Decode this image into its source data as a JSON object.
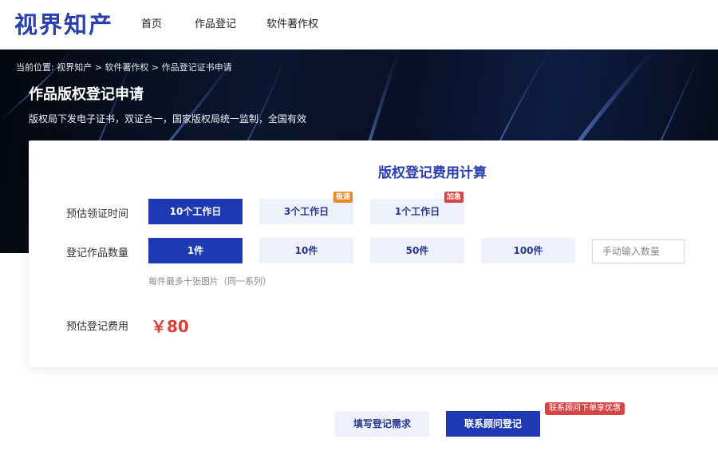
{
  "brand": {
    "logo_text": "视界知产"
  },
  "nav": {
    "items": [
      "首页",
      "作品登记",
      "软件著作权"
    ]
  },
  "hero": {
    "breadcrumb": "当前位置: 视界知产 > 软件著作权 > 作品登记证书申请",
    "title": "作品版权登记申请",
    "subtitle": "版权局下发电子证书，双证合一，国家版权局统一监制，全国有效"
  },
  "calculator": {
    "title": "版权登记费用计算",
    "time": {
      "label": "预估领证时间",
      "options": [
        {
          "label": "10个工作日",
          "selected": true,
          "tag": ""
        },
        {
          "label": "3个工作日",
          "selected": false,
          "tag": "极速"
        },
        {
          "label": "1个工作日",
          "selected": false,
          "tag": "加急"
        }
      ]
    },
    "quantity": {
      "label": "登记作品数量",
      "options": [
        {
          "label": "1件",
          "selected": true
        },
        {
          "label": "10件",
          "selected": false
        },
        {
          "label": "50件",
          "selected": false
        },
        {
          "label": "100件",
          "selected": false
        }
      ],
      "input_placeholder": "手动输入数量",
      "input_value": "",
      "hint": "每件最多十张图片（同一系列）"
    },
    "fee": {
      "label": "预估登记费用",
      "value": "￥80"
    }
  },
  "actions": {
    "fill_label": "填写登记需求",
    "contact_label": "联系顾问登记",
    "promo_badge": "联系顾问下单享优惠"
  },
  "colors": {
    "brand_blue": "#1f39b3",
    "accent_red": "#d9403a",
    "tag_orange": "#e88a2b",
    "light_option": "#eef1fb"
  }
}
